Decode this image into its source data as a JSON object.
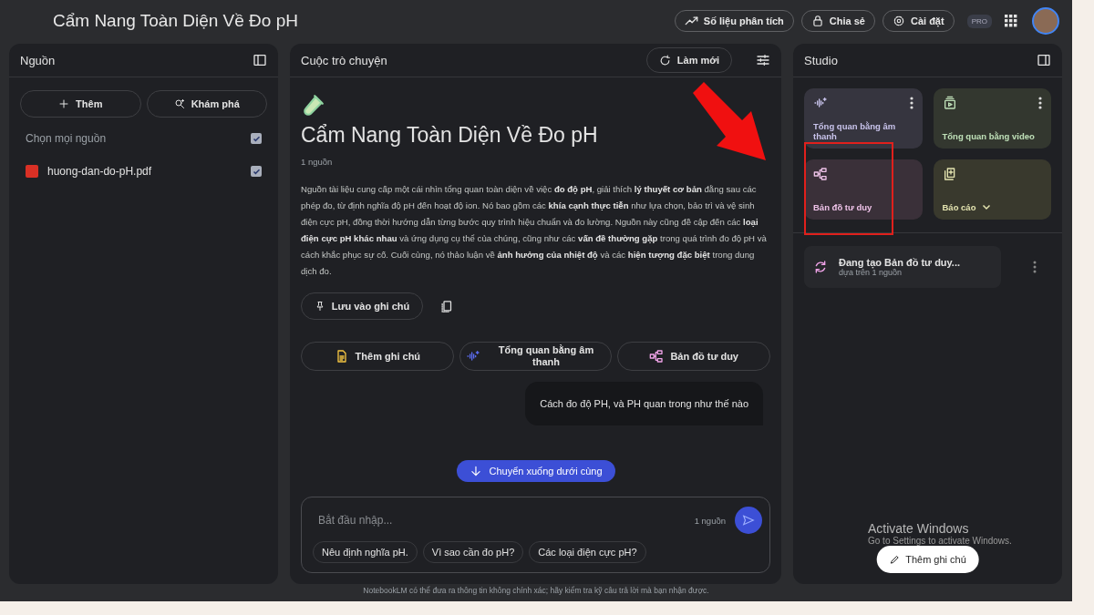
{
  "header": {
    "title": "Cẩm Nang Toàn Diện Về Đo pH",
    "buttons": [
      {
        "kind": "analytics",
        "label": "Số liệu phân tích"
      },
      {
        "kind": "share",
        "label": "Chia sẻ"
      },
      {
        "kind": "settings",
        "label": "Cài đặt"
      }
    ],
    "badge": "PRO"
  },
  "sources": {
    "title": "Nguồn",
    "actions": [
      {
        "kind": "add",
        "label": "Thêm"
      },
      {
        "kind": "discover",
        "label": "Khám phá"
      }
    ],
    "select_all": {
      "label": "Chọn mọi nguồn",
      "checked": true
    },
    "items": [
      {
        "name": "huong-dan-do-pH.pdf",
        "checked": true
      }
    ]
  },
  "chat": {
    "title": "Cuộc trò chuyện",
    "refresh": "Làm mới",
    "notebook_title": "Cẩm Nang Toàn Diện Về Đo pH",
    "source_count": "1 nguồn",
    "summary": "Nguồn tài liệu cung cấp một cái nhìn tổng quan toàn diện về việc **đo độ pH**, giải thích **lý thuyết cơ bản** đằng sau các phép đo, từ định nghĩa độ pH đến hoạt độ ion. Nó bao gồm các **khía cạnh thực tiễn** như lựa chọn, bảo trì và vệ sinh điện cực pH, đồng thời hướng dẫn từng bước quy trình hiệu chuẩn và đo lường. Nguồn này cũng đề cập đến các **loại điện cực pH khác nhau** và ứng dụng cụ thể của chúng, cũng như các **vấn đề thường gặp** trong quá trình đo độ pH và cách khắc phục sự cố. Cuối cùng, nó thảo luận về **ảnh hưởng của nhiệt độ** và các **hiện tượng đặc biệt** trong dung dịch đo.",
    "save_note": "Lưu vào ghi chú",
    "actions": [
      {
        "kind": "note",
        "label": "Thêm ghi chú"
      },
      {
        "kind": "audio",
        "label": "Tổng quan bằng âm thanh"
      },
      {
        "kind": "mindmap",
        "label": "Bản đồ tư duy"
      }
    ],
    "user_message": "Cách đo độ PH, và PH quan trong như thế nào",
    "scroll_button": "Chuyển xuống dưới cùng",
    "input": {
      "placeholder": "Bắt đầu nhập...",
      "source_count": "1 nguồn"
    },
    "suggestions": [
      "Nêu định nghĩa pH.",
      "Vì sao cần đo pH?",
      "Các loại điện cực pH?"
    ]
  },
  "studio": {
    "title": "Studio",
    "tiles": [
      {
        "kind": "audio",
        "label": "Tổng quan bằng âm thanh",
        "menu": true,
        "dropdown": false
      },
      {
        "kind": "video",
        "label": "Tổng quan bằng video",
        "menu": true,
        "dropdown": false
      },
      {
        "kind": "mindmap",
        "label": "Bản đồ tư duy",
        "menu": false,
        "dropdown": false
      },
      {
        "kind": "report",
        "label": "Báo cáo",
        "menu": false,
        "dropdown": true
      }
    ],
    "generating": {
      "title": "Đang tạo Bản đồ tư duy...",
      "subtitle": "dựa trên 1 nguồn"
    },
    "add_note": "Thêm ghi chú"
  },
  "windows_notice": {
    "title": "Activate Windows",
    "subtitle": "Go to Settings to activate Windows."
  },
  "footer": "NotebookLM có thể đưa ra thông tin không chính xác; hãy kiểm tra kỹ câu trả lời mà bạn nhận được."
}
